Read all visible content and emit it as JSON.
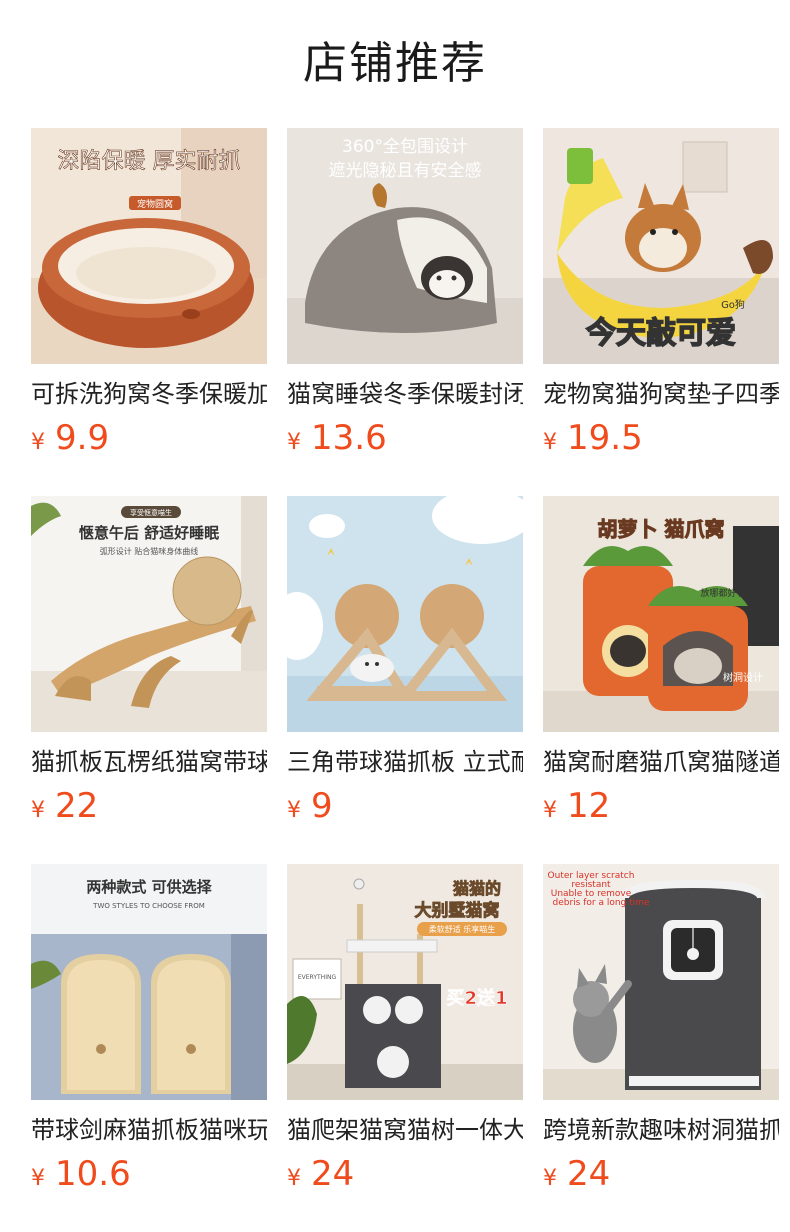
{
  "section_title": "店铺推荐",
  "currency": "¥",
  "products": [
    {
      "name": "可拆洗狗窝冬季保暖加厚宠物窝",
      "price": "9.9",
      "image_text": [
        "深陷保暖 厚实耐抓",
        "宠物圆窝"
      ]
    },
    {
      "name": "猫窝睡袋冬季保暖封闭式猫窝",
      "price": "13.6",
      "image_text": [
        "360°全包围设计",
        "遮光隐秘且有安全感"
      ]
    },
    {
      "name": "宠物窝猫狗窝垫子四季通用",
      "price": "19.5",
      "image_text": [
        "今天敲可爱",
        "Go狗"
      ]
    },
    {
      "name": "猫抓板瓦楞纸猫窝带球耐磨",
      "price": "22",
      "image_text": [
        "享受惬意喵生",
        "惬意午后 舒适好睡眠",
        "弧形设计 贴合猫咪身体曲线"
      ]
    },
    {
      "name": "三角带球猫抓板 立式耐磨",
      "price": "9",
      "image_text": []
    },
    {
      "name": "猫窝耐磨猫爪窝猫隧道",
      "price": "12",
      "image_text": [
        "胡萝卜 猫爪窝",
        "放哪都好看",
        "树洞设计"
      ]
    },
    {
      "name": "带球剑麻猫抓板猫咪玩具",
      "price": "10.6",
      "image_text": [
        "两种款式 可供选择",
        "TWO STYLES TO CHOOSE FROM"
      ]
    },
    {
      "name": "猫爬架猫窝猫树一体大型",
      "price": "24",
      "image_text": [
        "猫猫的",
        "大别墅猫窝",
        "柔软舒适 乐享喵生",
        "买2送1",
        "EVERYTHING"
      ]
    },
    {
      "name": "跨境新款趣味树洞猫抓柱",
      "price": "24",
      "image_text": [
        "Outer layer scratch",
        "resistant",
        "Unable to remove",
        "debris for a long time"
      ]
    }
  ],
  "colors": {
    "price": "#ef4b1d",
    "title": "#1a1a1a",
    "name": "#222222"
  }
}
